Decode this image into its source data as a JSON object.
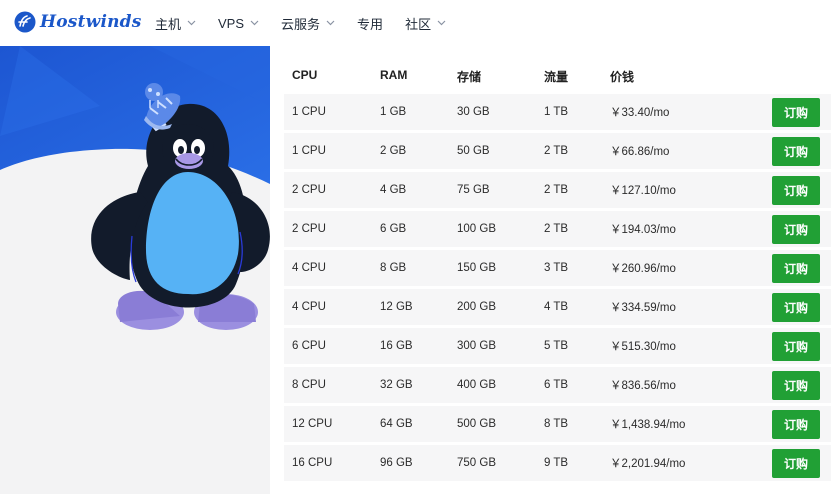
{
  "brand": {
    "name": "Hostwinds",
    "color": "#1b57c9"
  },
  "nav": {
    "items": [
      {
        "label": "主机",
        "has_dropdown": true
      },
      {
        "label": "VPS",
        "has_dropdown": true
      },
      {
        "label": "云服务",
        "has_dropdown": true
      },
      {
        "label": "专用",
        "has_dropdown": false
      },
      {
        "label": "社区",
        "has_dropdown": true
      }
    ]
  },
  "table": {
    "headers": {
      "cpu": "CPU",
      "ram": "RAM",
      "storage": "存储",
      "traffic": "流量",
      "price": "价钱"
    },
    "order_label": "订购",
    "order_color": "#21a035",
    "rows": [
      {
        "cpu": "1 CPU",
        "ram": "1 GB",
        "storage": "30 GB",
        "traffic": "1 TB",
        "price": "￥33.40/mo"
      },
      {
        "cpu": "1 CPU",
        "ram": "2 GB",
        "storage": "50 GB",
        "traffic": "2 TB",
        "price": "￥66.86/mo"
      },
      {
        "cpu": "2 CPU",
        "ram": "4 GB",
        "storage": "75 GB",
        "traffic": "2 TB",
        "price": "￥127.10/mo"
      },
      {
        "cpu": "2 CPU",
        "ram": "6 GB",
        "storage": "100 GB",
        "traffic": "2 TB",
        "price": "￥194.03/mo"
      },
      {
        "cpu": "4 CPU",
        "ram": "8 GB",
        "storage": "150 GB",
        "traffic": "3 TB",
        "price": "￥260.96/mo"
      },
      {
        "cpu": "4 CPU",
        "ram": "12 GB",
        "storage": "200 GB",
        "traffic": "4 TB",
        "price": "￥334.59/mo"
      },
      {
        "cpu": "6 CPU",
        "ram": "16 GB",
        "storage": "300 GB",
        "traffic": "5 TB",
        "price": "￥515.30/mo"
      },
      {
        "cpu": "8 CPU",
        "ram": "32 GB",
        "storage": "400 GB",
        "traffic": "6 TB",
        "price": "￥836.56/mo"
      },
      {
        "cpu": "12 CPU",
        "ram": "64 GB",
        "storage": "500 GB",
        "traffic": "8 TB",
        "price": "￥1,438.94/mo"
      },
      {
        "cpu": "16 CPU",
        "ram": "96 GB",
        "storage": "750 GB",
        "traffic": "9 TB",
        "price": "￥2,201.94/mo"
      }
    ]
  },
  "hero": {
    "illustration": "penguin-mascot-icon",
    "accent": "#1f5fd8"
  }
}
